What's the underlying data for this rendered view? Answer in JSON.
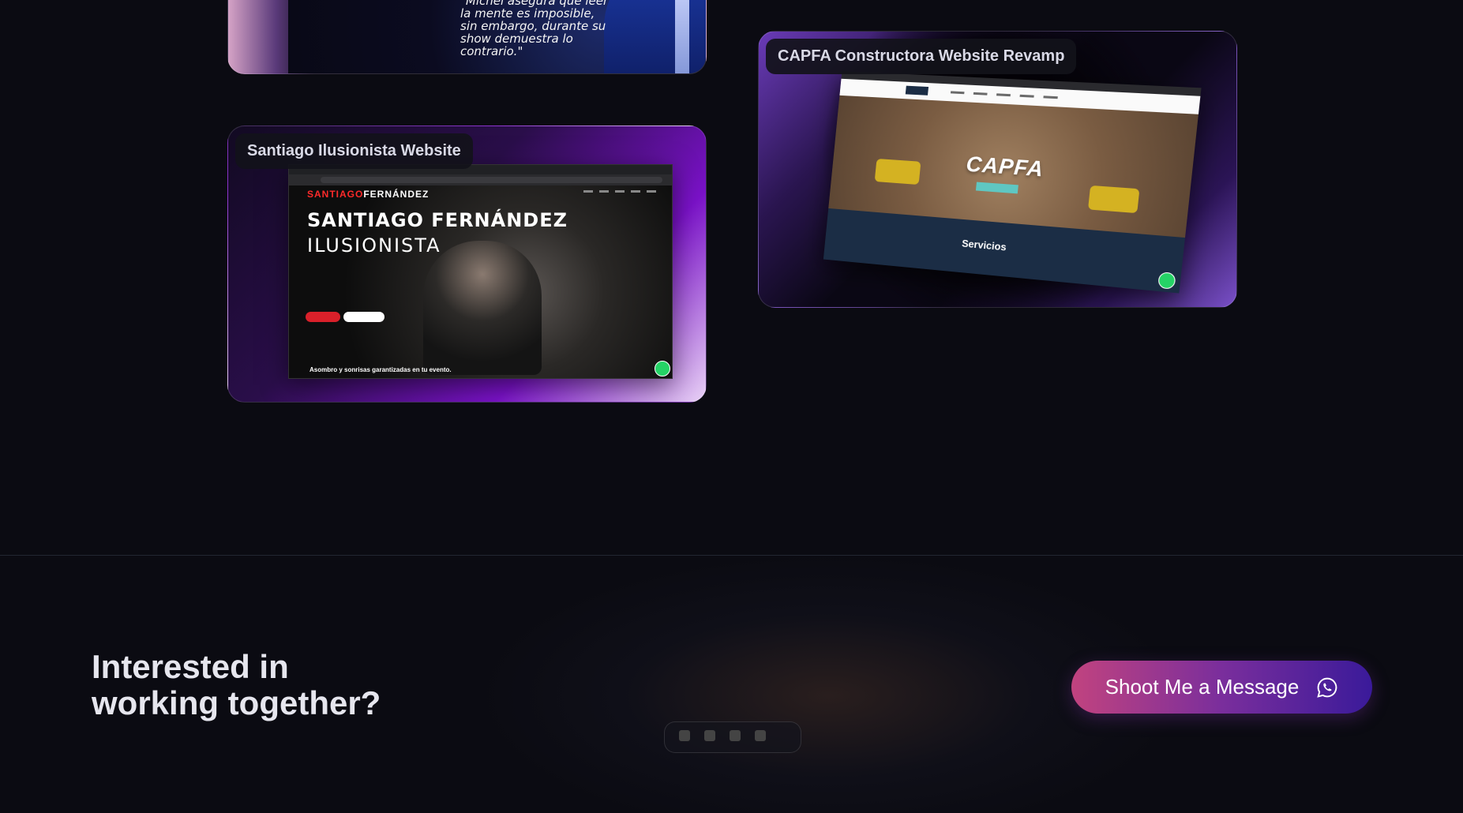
{
  "projects": {
    "top_card": {
      "quote": "\"Michel asegura que leer la mente es imposible, sin embargo, durante su show demuestra lo contrario.\""
    },
    "santiago": {
      "label": "Santiago Ilusionista Website",
      "brand_red": "SANTIAGO",
      "brand_white": "FERNÁNDEZ",
      "hero_title": "SANTIAGO FERNÁNDEZ",
      "hero_subtitle": "ILUSIONISTA",
      "tagline": "Asombro y sonrisas garantizadas en tu evento."
    },
    "capfa": {
      "label": "CAPFA Constructora Website Revamp",
      "hero_title": "CAPFA",
      "section_title": "Servicios"
    }
  },
  "cta": {
    "heading_line1": "Interested in",
    "heading_line2": "working together?",
    "button_label": "Shoot Me a Message",
    "button_icon": "whatsapp-icon"
  },
  "colors": {
    "accent_pink": "#c1437f",
    "accent_purple": "#3a1a9a",
    "whatsapp_green": "#25d366",
    "background": "#0b0b12"
  }
}
